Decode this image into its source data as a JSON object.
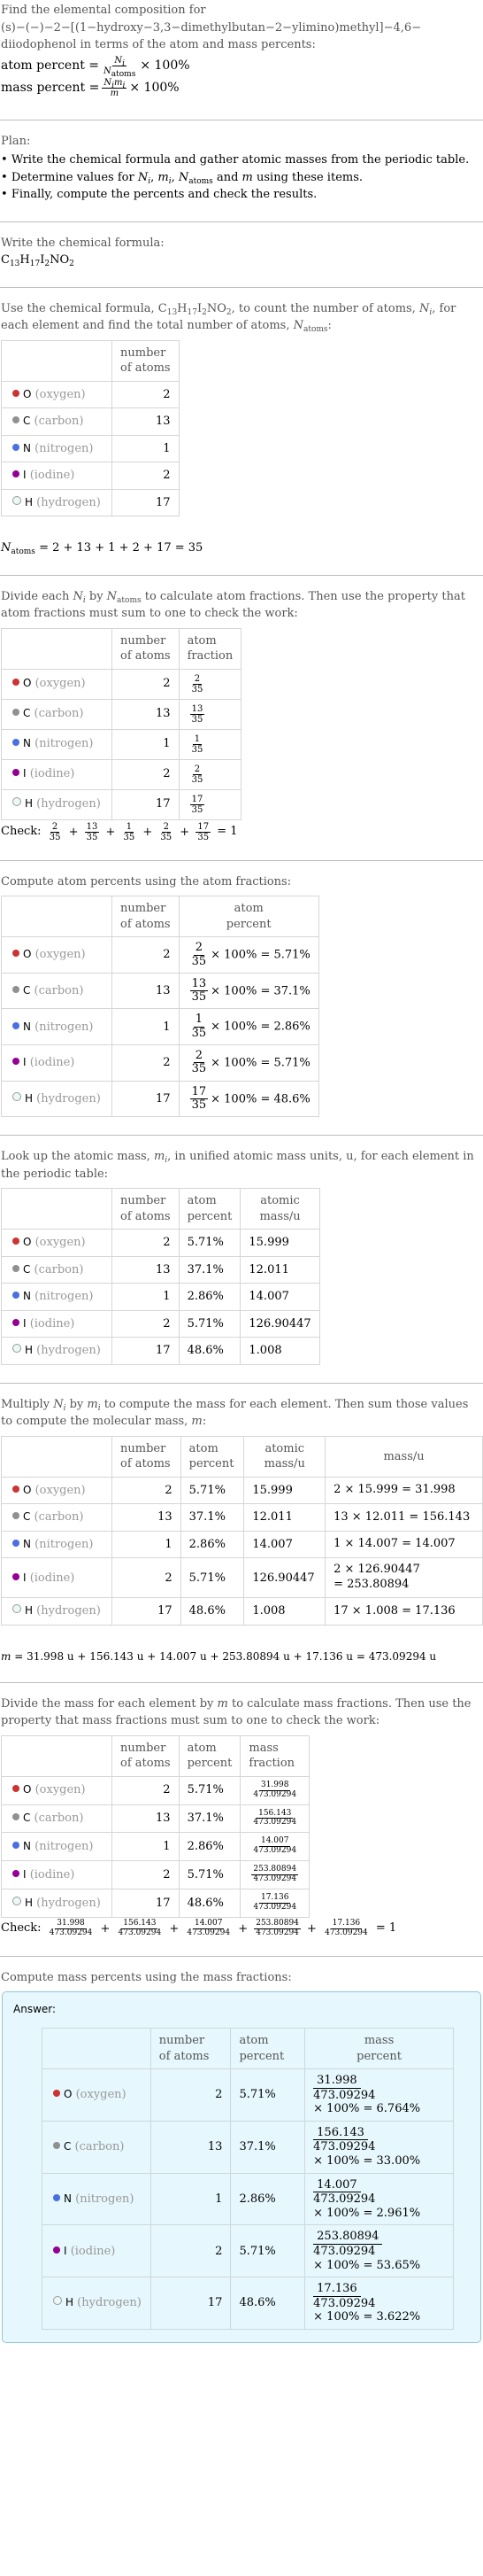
{
  "intro": {
    "title_line1": "Find the elemental composition for",
    "title_line2": "(s)−(−)−2−[(1−hydroxy−3,3−dimethylbutan−2−ylimino)methyl]−4,6−",
    "title_line3": "diiodophenol in terms of the atom and mass percents:",
    "atom_percent_label": "atom percent =",
    "atom_percent_num": "N",
    "atom_percent_num_sub": "i",
    "atom_percent_den": "N",
    "atom_percent_den_sub": "atoms",
    "times_100": "× 100%",
    "mass_percent_label": "mass percent =",
    "mass_percent_num": "N",
    "mass_percent_num_sub": "i",
    "mass_percent_num2": "m",
    "mass_percent_num2_sub": "i",
    "mass_percent_den": "m"
  },
  "plan": {
    "heading": "Plan:",
    "items": [
      "Write the chemical formula and gather atomic masses from the periodic table.",
      "Determine values for N_i, m_i, N_atoms and m using these items.",
      "Finally, compute the percents and check the results."
    ],
    "item2_prefix": "Determine values for ",
    "item2_suffix": " using these items."
  },
  "formula_section": {
    "heading": "Write the chemical formula:",
    "formula": "C13H17I2NO2"
  },
  "elements": [
    {
      "symbol": "O",
      "name": "(oxygen)",
      "color": "#cc3333",
      "count": "2",
      "atom_fraction_num": "2",
      "atom_fraction_den": "35",
      "atom_percent": "5.71%",
      "atomic_mass": "15.999",
      "mass_calc": "2 × 15.999 = 31.998",
      "mass": "31.998",
      "mass_percent": "6.764%"
    },
    {
      "symbol": "C",
      "name": "(carbon)",
      "color": "#909090",
      "count": "13",
      "atom_fraction_num": "13",
      "atom_fraction_den": "35",
      "atom_percent": "37.1%",
      "atomic_mass": "12.011",
      "mass_calc": "13 × 12.011 = 156.143",
      "mass": "156.143",
      "mass_percent": "33.00%"
    },
    {
      "symbol": "N",
      "name": "(nitrogen)",
      "color": "#4a6fe0",
      "count": "1",
      "atom_fraction_num": "1",
      "atom_fraction_den": "35",
      "atom_percent": "2.86%",
      "atomic_mass": "14.007",
      "mass_calc": "1 × 14.007 = 14.007",
      "mass": "14.007",
      "mass_percent": "2.961%"
    },
    {
      "symbol": "I",
      "name": "(iodine)",
      "color": "#940094",
      "count": "2",
      "atom_fraction_num": "2",
      "atom_fraction_den": "35",
      "atom_percent": "5.71%",
      "atomic_mass": "126.90447",
      "mass_calc": "2 × 126.90447 = 253.80894",
      "mass_calc_line1": "2 × 126.90447",
      "mass_calc_line2": "= 253.80894",
      "mass": "253.80894",
      "mass_percent": "53.65%"
    },
    {
      "symbol": "H",
      "name": "(hydrogen)",
      "color": "#eaf8f8",
      "count": "17",
      "atom_fraction_num": "17",
      "atom_fraction_den": "35",
      "atom_percent": "48.6%",
      "atomic_mass": "1.008",
      "mass_calc": "17 × 1.008 = 17.136",
      "mass": "17.136",
      "mass_percent": "3.622%"
    }
  ],
  "headers": {
    "number_of_atoms_1": "number",
    "number_of_atoms_2": "of atoms",
    "atom_fraction_1": "atom",
    "atom_fraction_2": "fraction",
    "atom_percent_1": "atom",
    "atom_percent_2": "percent",
    "atomic_mass_1": "atomic",
    "atomic_mass_2": "mass/u",
    "mass": "mass/u",
    "mass_fraction_1": "mass",
    "mass_fraction_2": "fraction",
    "mass_percent_1": "mass",
    "mass_percent_2": "percent"
  },
  "count_section": {
    "text_a": "Use the chemical formula, ",
    "text_b": ", to count the number of atoms, ",
    "text_c": ", for each element and find the total number of atoms, ",
    "text_d": ":",
    "total_equation": "= 2 + 13 + 1 + 2 + 17 = 35"
  },
  "fraction_section": {
    "text_a": "Divide each ",
    "text_b": " by ",
    "text_c": " to calculate atom fractions. Then use the property that atom fractions must sum to one to check the work:",
    "check_label": "Check:",
    "check_result": "= 1"
  },
  "atom_percent_section": {
    "text": "Compute atom percents using the atom fractions:",
    "times_100": "× 100% ="
  },
  "atomic_mass_section": {
    "text_a": "Look up the atomic mass, ",
    "text_b": ", in unified atomic mass units, u, for each element in the periodic table:"
  },
  "mass_section": {
    "text_a": "Multiply ",
    "text_b": " by ",
    "text_c": " to compute the mass for each element. Then sum those values to compute the molecular mass, ",
    "text_d": ":",
    "total_equation": "= 31.998 u + 156.143 u + 14.007 u + 253.80894 u + 17.136 u = 473.09294 u"
  },
  "mass_fraction_section": {
    "text_a": "Divide the mass for each element by ",
    "text_b": " to calculate mass fractions. Then use the property that mass fractions must sum to one to check the work:",
    "denominator": "473.09294",
    "check_label": "Check:",
    "check_result": "= 1"
  },
  "mass_percent_section": {
    "text": "Compute mass percents using the mass fractions:",
    "answer_label": "Answer:",
    "denominator": "473.09294",
    "times_100": "× 100% ="
  }
}
